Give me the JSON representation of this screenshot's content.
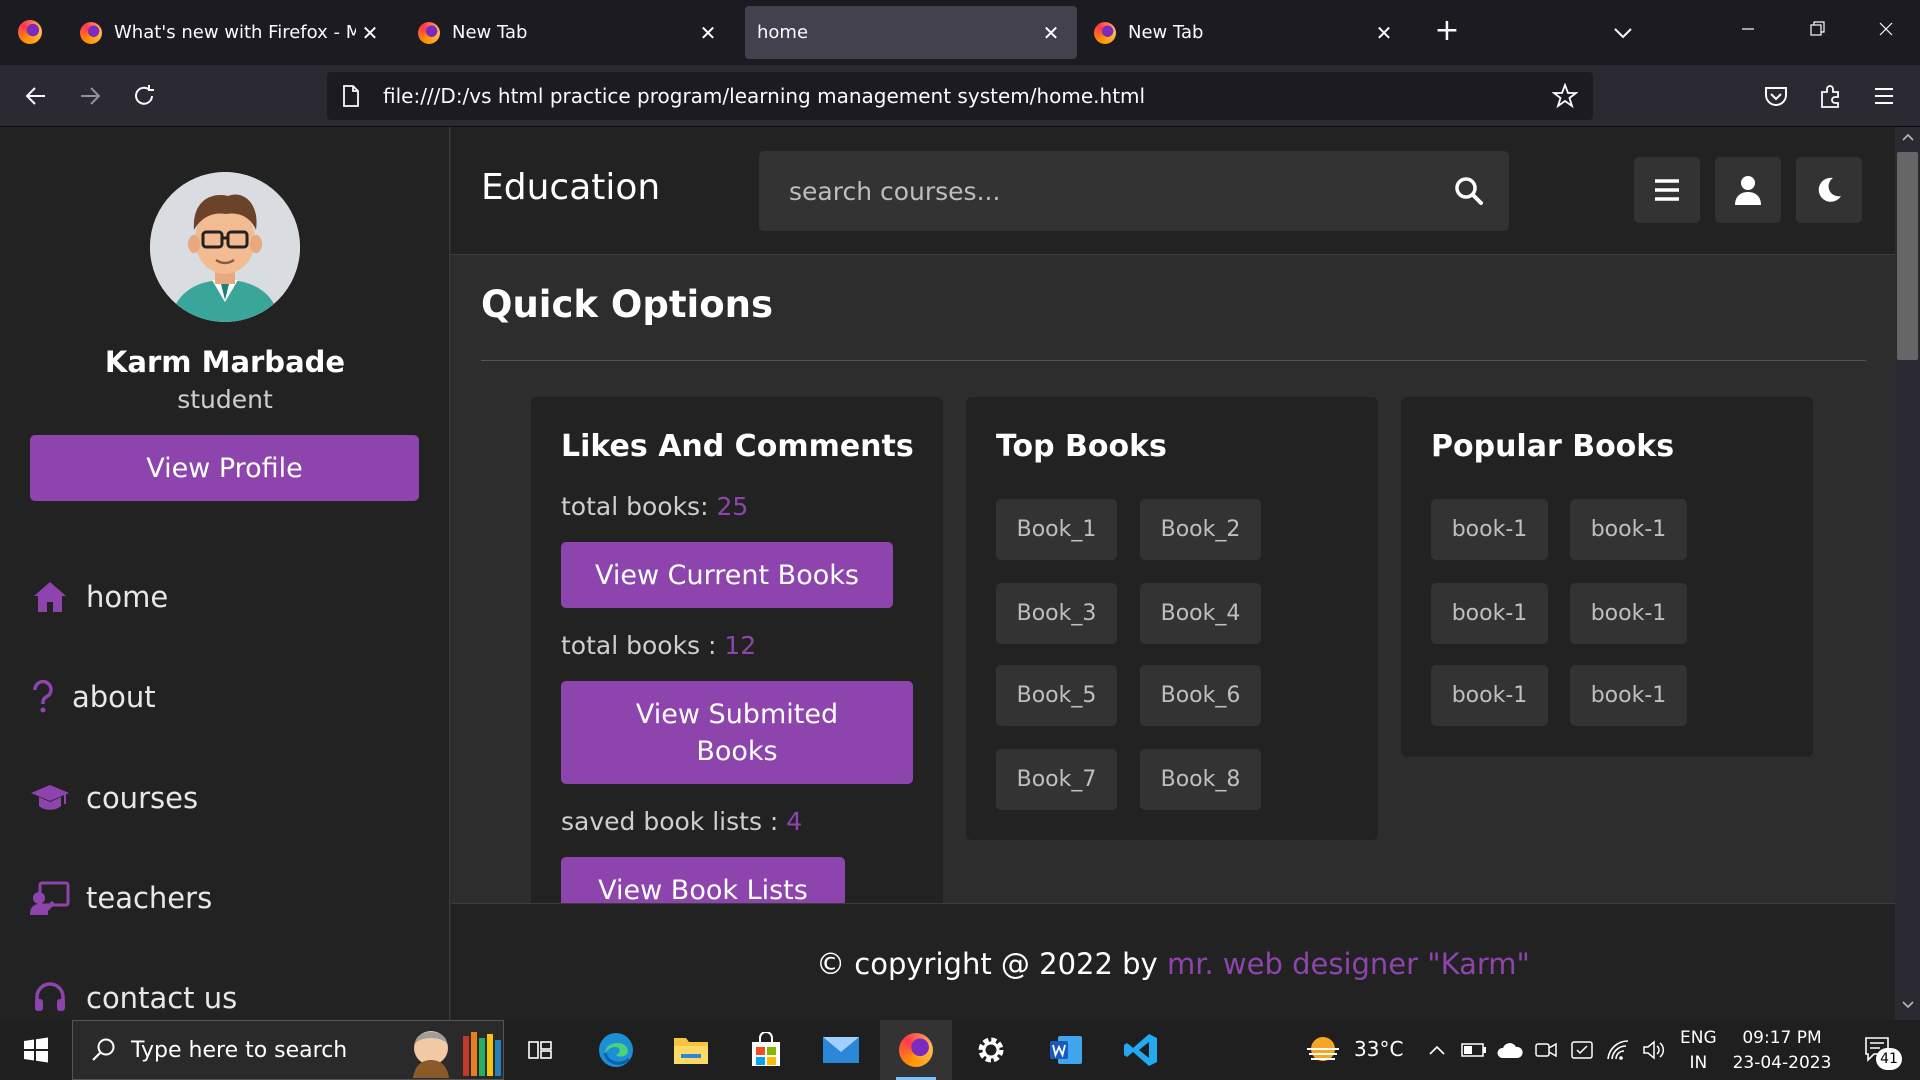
{
  "browser": {
    "tabs": [
      {
        "title": "What's new with Firefox - More",
        "active": false
      },
      {
        "title": "New Tab",
        "active": false
      },
      {
        "title": "home",
        "active": true
      },
      {
        "title": "New Tab",
        "active": false
      }
    ],
    "tab_close_glyph": "✕",
    "new_tab_glyph": "+",
    "url": "file:///D:/vs html practice program/learning management system/home.html"
  },
  "sidebar": {
    "name": "Karm Marbade",
    "role": "student",
    "view_profile_label": "View Profile",
    "nav": [
      {
        "label": "home",
        "icon": "home-icon"
      },
      {
        "label": "about",
        "icon": "question-icon"
      },
      {
        "label": "courses",
        "icon": "graduation-cap-icon"
      },
      {
        "label": "teachers",
        "icon": "chalkboard-teacher-icon"
      },
      {
        "label": "contact us",
        "icon": "headset-icon"
      }
    ]
  },
  "header": {
    "logo": "Education",
    "search_placeholder": "search courses..."
  },
  "main": {
    "heading": "Quick Options",
    "likes_box": {
      "title": "Likes And Comments",
      "stats": [
        {
          "label": "total books: ",
          "value": "25"
        },
        {
          "label": "total books : ",
          "value": "12"
        },
        {
          "label": "saved book lists : ",
          "value": "4"
        }
      ],
      "buttons": [
        "View Current Books",
        "View Submited Books",
        "View Book Lists"
      ]
    },
    "top_books": {
      "title": "Top Books",
      "items": [
        "Book_1",
        "Book_2",
        "Book_3",
        "Book_4",
        "Book_5",
        "Book_6",
        "Book_7",
        "Book_8"
      ]
    },
    "popular_books": {
      "title": "Popular Books",
      "items": [
        "book-1",
        "book-1",
        "book-1",
        "book-1",
        "book-1",
        "book-1"
      ]
    }
  },
  "footer": {
    "prefix": "© copyright @ 2022 by ",
    "link": "mr. web designer \"Karm\""
  },
  "taskbar": {
    "search_placeholder": "Type here to search",
    "weather": "33°C",
    "lang_line1": "ENG",
    "lang_line2": "IN",
    "time": "09:17 PM",
    "date": "23-04-2023",
    "notifications": "41"
  },
  "colors": {
    "accent": "#8e44ad",
    "sidebar_bg": "#222222",
    "content_bg": "#2d2d2d",
    "tag_bg": "#333333"
  }
}
